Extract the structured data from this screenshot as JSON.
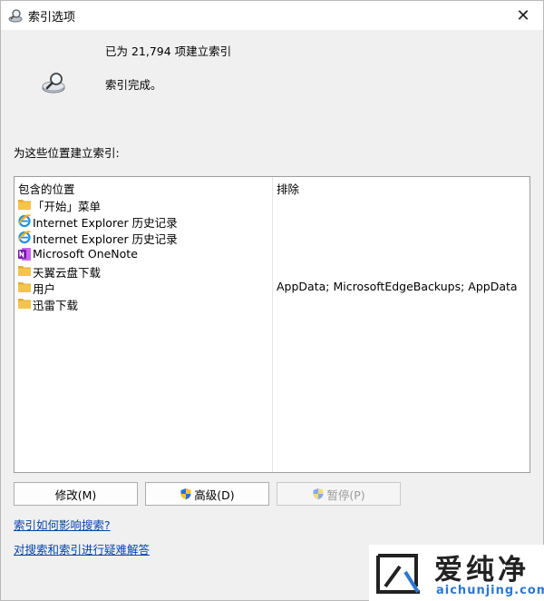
{
  "window": {
    "title": "索引选项",
    "close_glyph": "✕"
  },
  "status": {
    "indexed_count": "已为 21,794 项建立索引",
    "state": "索引完成。"
  },
  "section_label": "为这些位置建立索引:",
  "table": {
    "col_included": "包含的位置",
    "col_excluded": "排除",
    "rows": [
      {
        "icon": "folder-icon",
        "name": "「开始」菜单",
        "excluded": ""
      },
      {
        "icon": "internet-explorer-icon",
        "name": "Internet Explorer 历史记录",
        "excluded": ""
      },
      {
        "icon": "internet-explorer-icon",
        "name": "Internet Explorer 历史记录",
        "excluded": ""
      },
      {
        "icon": "onenote-icon",
        "name": "Microsoft OneNote",
        "excluded": ""
      },
      {
        "icon": "folder-icon",
        "name": "天翼云盘下载",
        "excluded": ""
      },
      {
        "icon": "folder-icon",
        "name": "用户",
        "excluded": "AppData; MicrosoftEdgeBackups; AppData"
      },
      {
        "icon": "folder-icon",
        "name": "迅雷下载",
        "excluded": ""
      }
    ]
  },
  "buttons": {
    "modify": "修改(M)",
    "advanced": "高级(D)",
    "pause": "暂停(P)"
  },
  "links": {
    "affect_search": "索引如何影响搜索?",
    "troubleshoot": "对搜索和索引进行疑难解答"
  },
  "watermark": {
    "title": "爱纯净",
    "url": "aichunjing.com"
  },
  "colors": {
    "link": "#0645ad",
    "folder": "#f5c54a",
    "onenote": "#7719aa",
    "watermark_url": "#2b78d0"
  }
}
